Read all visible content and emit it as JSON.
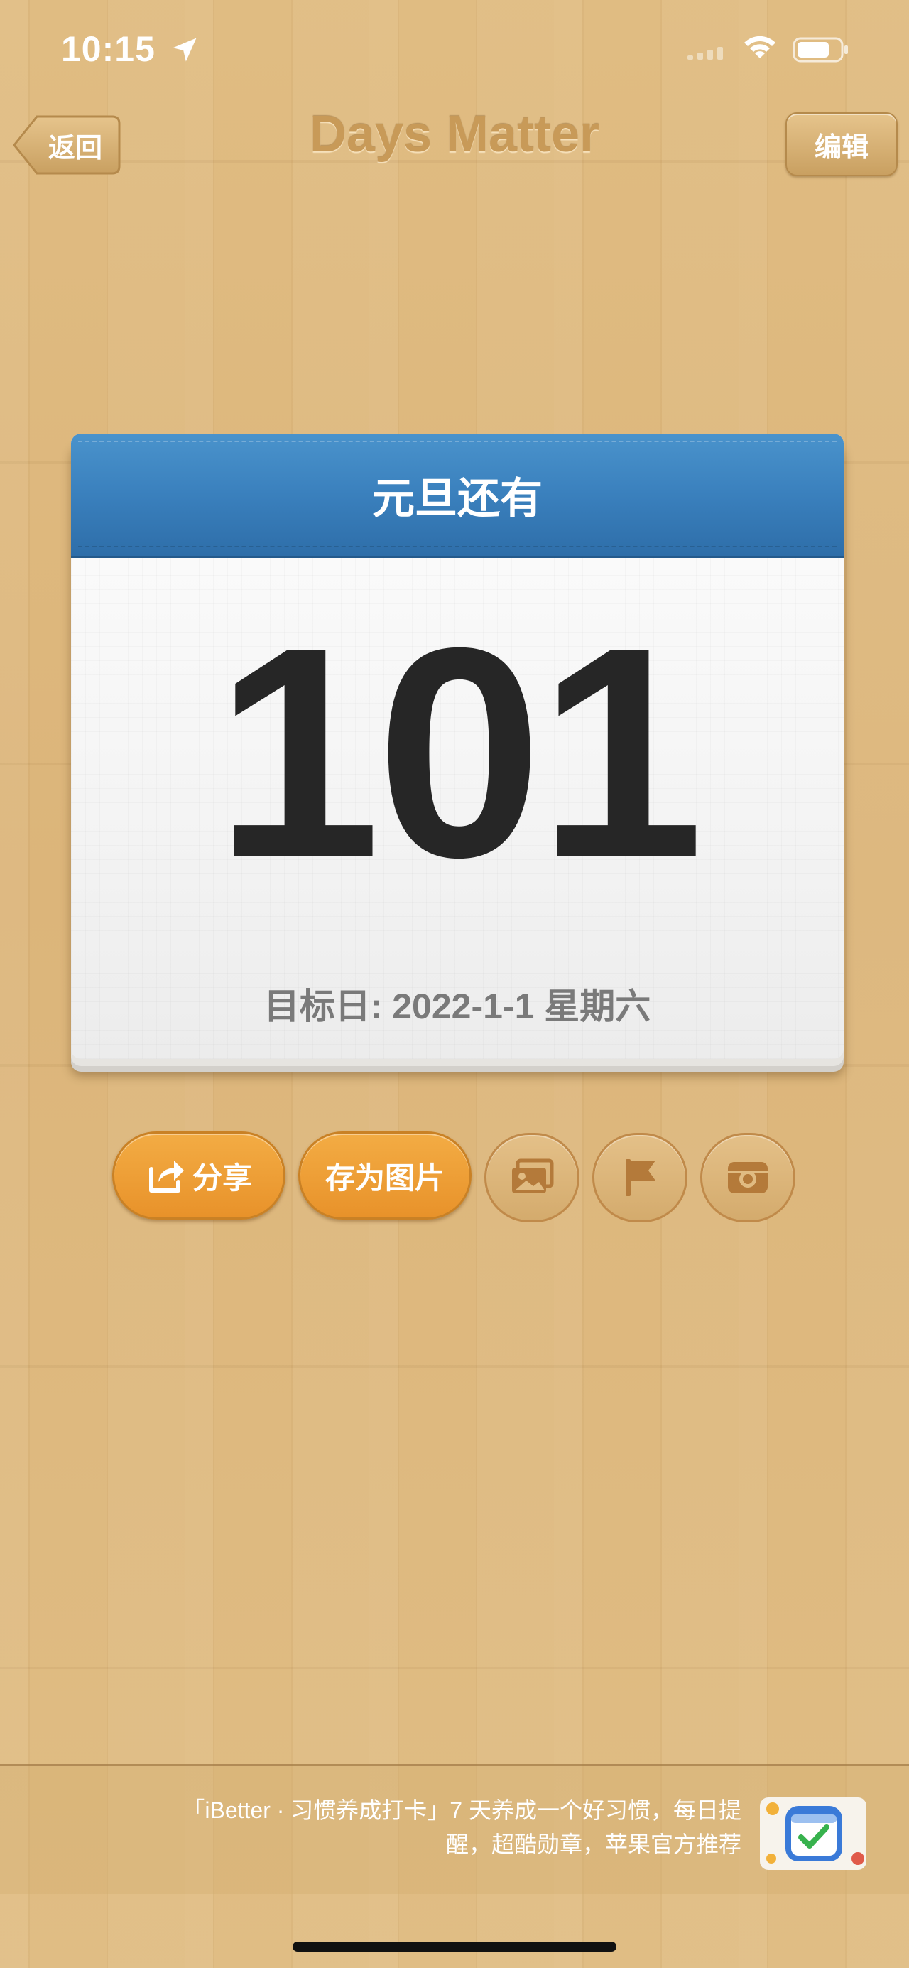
{
  "status_bar": {
    "time": "10:15",
    "icons": [
      "location-arrow-icon",
      "signal-icon",
      "wifi-icon",
      "battery-icon"
    ]
  },
  "nav": {
    "back_label": "返回",
    "title": "Days Matter",
    "edit_label": "编辑"
  },
  "card": {
    "header": "元旦还有",
    "days": "101",
    "target_date": "目标日: 2022-1-1 星期六",
    "header_color": "#3a80bd"
  },
  "actions": {
    "share_label": "分享",
    "save_image_label": "存为图片",
    "icons": [
      "share-icon",
      "photo-icon",
      "flag-icon",
      "camera-icon"
    ],
    "accent": "#ed9b31"
  },
  "ad": {
    "line1": "「iBetter · 习惯养成打卡」7 天养成一个好习惯，每日提",
    "line2": "醒，超酷勋章，苹果官方推荐",
    "icon": "ibetter-app-icon"
  }
}
